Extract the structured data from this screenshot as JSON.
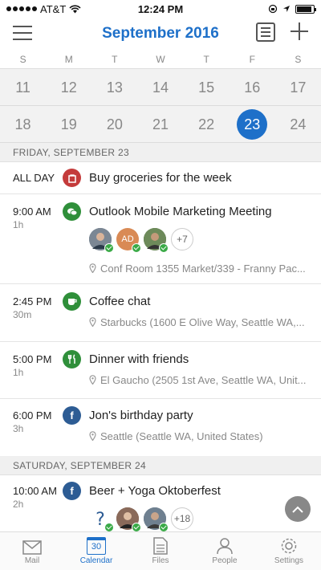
{
  "status_bar": {
    "carrier": "AT&T",
    "time": "12:24 PM"
  },
  "header": {
    "title": "September 2016"
  },
  "weekdays": [
    "S",
    "M",
    "T",
    "W",
    "T",
    "F",
    "S"
  ],
  "weeks": [
    [
      "11",
      "12",
      "13",
      "14",
      "15",
      "16",
      "17"
    ],
    [
      "18",
      "19",
      "20",
      "21",
      "22",
      "23",
      "24"
    ]
  ],
  "selected_day": "23",
  "agenda": {
    "day1": {
      "header": "FRIDAY, SEPTEMBER 23",
      "events": [
        {
          "time": "ALL DAY",
          "duration": "",
          "title": "Buy groceries for the week",
          "location": "",
          "icon": "bag-icon",
          "color": "#c43b3b"
        },
        {
          "time": "9:00 AM",
          "duration": "1h",
          "title": "Outlook Mobile Marketing Meeting",
          "location": "Conf Room 1355 Market/339 - Franny Pac...",
          "icon": "chat-bubbles-icon",
          "color": "#2f8f3a",
          "attendee_initials": "AD",
          "more_count": "+7"
        },
        {
          "time": "2:45 PM",
          "duration": "30m",
          "title": "Coffee chat",
          "location": "Starbucks (1600 E Olive Way, Seattle WA,...",
          "icon": "coffee-cup-icon",
          "color": "#2f8f3a"
        },
        {
          "time": "5:00 PM",
          "duration": "1h",
          "title": "Dinner with friends",
          "location": "El Gaucho (2505 1st Ave, Seattle WA, Unit...",
          "icon": "fork-knife-icon",
          "color": "#2f8f3a"
        },
        {
          "time": "6:00 PM",
          "duration": "3h",
          "title": "Jon's birthday party",
          "location": "Seattle (Seattle WA, United States)",
          "icon": "facebook-icon",
          "color": "#2d5c94"
        }
      ]
    },
    "day2": {
      "header": "SATURDAY, SEPTEMBER 24",
      "events": [
        {
          "time": "10:00 AM",
          "duration": "2h",
          "title": "Beer + Yoga Oktoberfest",
          "location": "",
          "icon": "facebook-icon",
          "color": "#2d5c94",
          "more_count": "+18"
        }
      ]
    }
  },
  "tabbar": {
    "tabs": [
      {
        "label": "Mail",
        "icon": "envelope-icon"
      },
      {
        "label": "Calendar",
        "icon": "calendar-icon",
        "day": "30",
        "active": true
      },
      {
        "label": "Files",
        "icon": "file-icon"
      },
      {
        "label": "People",
        "icon": "person-icon"
      },
      {
        "label": "Settings",
        "icon": "gear-icon"
      }
    ]
  },
  "colors": {
    "accent": "#1e70c9",
    "accepted": "#3aaa47"
  }
}
